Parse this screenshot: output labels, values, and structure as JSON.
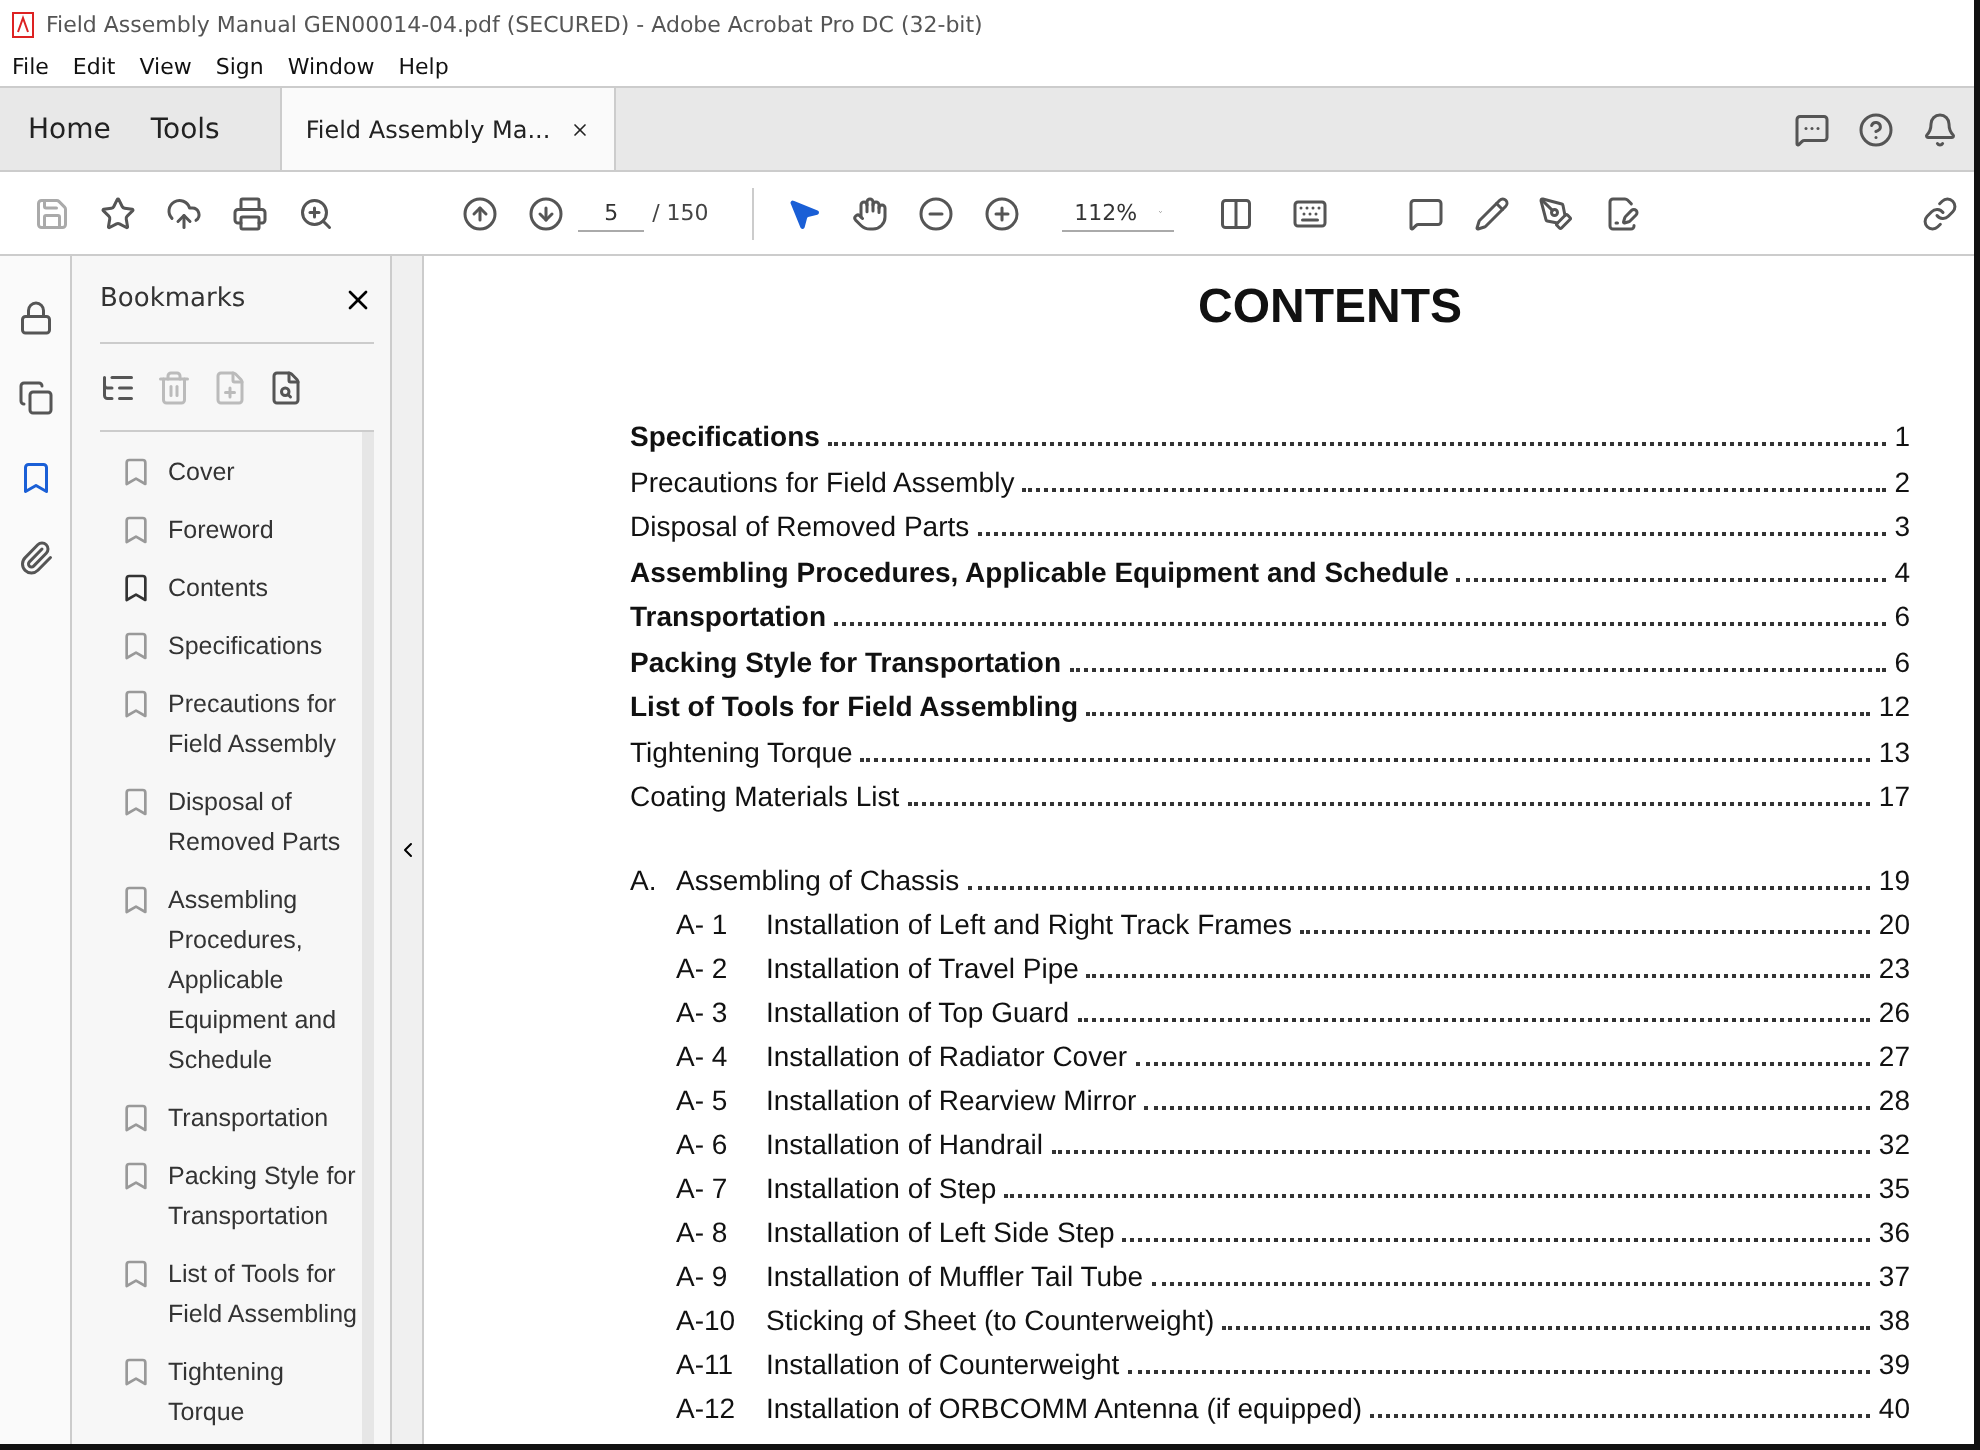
{
  "window": {
    "title": "Field Assembly Manual GEN00014-04.pdf (SECURED) - Adobe Acrobat Pro DC (32-bit)"
  },
  "menu": [
    "File",
    "Edit",
    "View",
    "Sign",
    "Window",
    "Help"
  ],
  "tabs": [
    {
      "label": "Home",
      "kind": "nav",
      "selected": false
    },
    {
      "label": "Tools",
      "kind": "nav",
      "selected": false
    },
    {
      "label": "Field Assembly Ma...",
      "kind": "document",
      "selected": true
    }
  ],
  "toolbar": {
    "page": "5",
    "page_total": "/ 150",
    "zoom": "112%"
  },
  "bookmarks": {
    "title": "Bookmarks",
    "items": [
      {
        "label": "Cover",
        "selected": false
      },
      {
        "label": "Foreword",
        "selected": false
      },
      {
        "label": "Contents",
        "selected": true
      },
      {
        "label": "Specifications",
        "selected": false
      },
      {
        "label": "Precautions for Field Assembly",
        "selected": false
      },
      {
        "label": "Disposal of Removed Parts",
        "selected": false
      },
      {
        "label": "Assembling Procedures, Applicable Equipment and Schedule",
        "selected": false
      },
      {
        "label": "Transportation",
        "selected": false
      },
      {
        "label": "Packing Style for Transportation",
        "selected": false
      },
      {
        "label": "List of Tools for Field Assembling",
        "selected": false
      },
      {
        "label": "Tightening Torque",
        "selected": false
      }
    ]
  },
  "document": {
    "heading": "CONTENTS",
    "entries": [
      {
        "title": "Specifications",
        "page": "1",
        "bold": true
      },
      {
        "title": "Precautions for Field Assembly",
        "page": "2",
        "bold": false
      },
      {
        "title": "Disposal of Removed Parts",
        "page": "3",
        "bold": false
      },
      {
        "title": "Assembling Procedures, Applicable Equipment and Schedule",
        "page": "4",
        "bold": true
      },
      {
        "title": "Transportation",
        "page": "6",
        "bold": true
      },
      {
        "title": "Packing Style for Transportation",
        "page": "6",
        "bold": true
      },
      {
        "title": "List of Tools for Field Assembling",
        "page": "12",
        "bold": true
      },
      {
        "title": "Tightening Torque",
        "page": "13",
        "bold": false
      },
      {
        "title": "Coating Materials List",
        "page": "17",
        "bold": false
      }
    ],
    "chapter": {
      "number": "A.",
      "title": "Assembling of Chassis",
      "page": "19",
      "entries": [
        {
          "number": "A- 1",
          "title": "Installation of Left and Right Track Frames",
          "page": "20"
        },
        {
          "number": "A- 2",
          "title": "Installation of Travel Pipe",
          "page": "23"
        },
        {
          "number": "A- 3",
          "title": "Installation of Top Guard",
          "page": "26"
        },
        {
          "number": "A- 4",
          "title": "Installation of Radiator Cover",
          "page": "27"
        },
        {
          "number": "A- 5",
          "title": "Installation of Rearview Mirror",
          "page": "28"
        },
        {
          "number": "A- 6",
          "title": "Installation of Handrail",
          "page": "32"
        },
        {
          "number": "A- 7",
          "title": "Installation of Step",
          "page": "35"
        },
        {
          "number": "A- 8",
          "title": "Installation of Left Side Step",
          "page": "36"
        },
        {
          "number": "A- 9",
          "title": "Installation of Muffler Tail Tube",
          "page": "37"
        },
        {
          "number": "A-10",
          "title": "Sticking of Sheet (to Counterweight)",
          "page": "38"
        },
        {
          "number": "A-11",
          "title": "Installation of Counterweight",
          "page": "39"
        },
        {
          "number": "A-12",
          "title": "Installation of ORBCOMM Antenna (if equipped)",
          "page": "40"
        }
      ]
    }
  }
}
